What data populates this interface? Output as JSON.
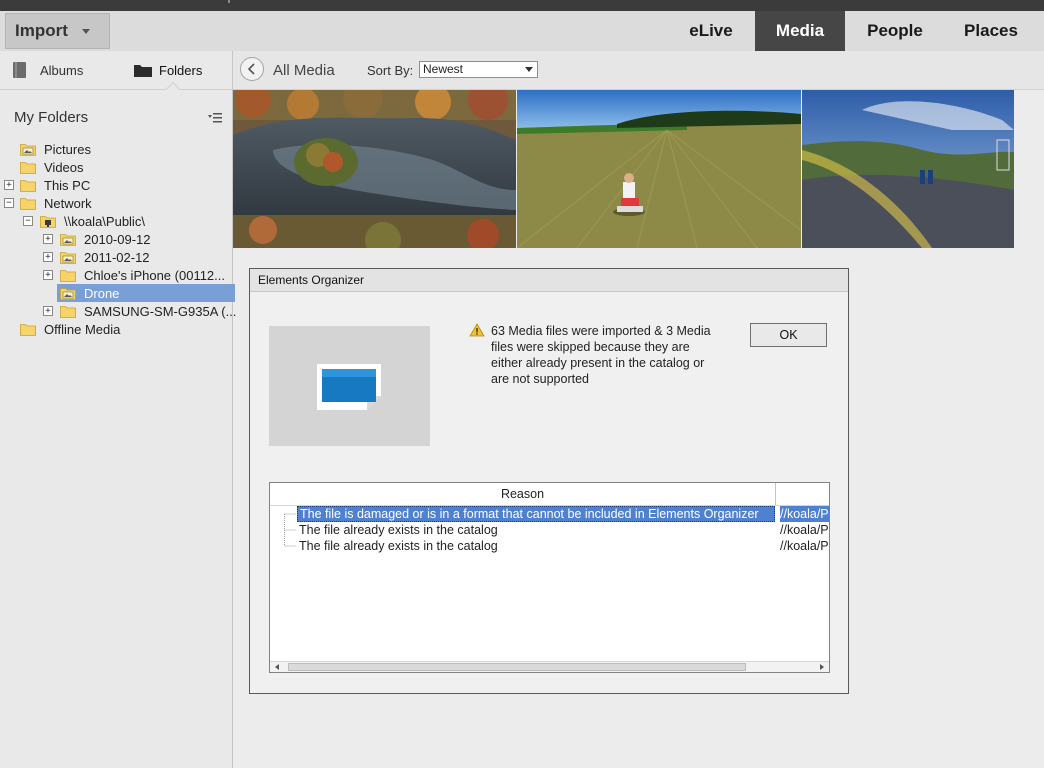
{
  "header": {
    "import_label": "Import",
    "tabs": [
      {
        "label": "eLive",
        "active": false
      },
      {
        "label": "Media",
        "active": true
      },
      {
        "label": "People",
        "active": false
      },
      {
        "label": "Places",
        "active": false
      }
    ]
  },
  "sidebar": {
    "tabs": [
      {
        "label": "Albums",
        "icon": "album-icon",
        "active": false
      },
      {
        "label": "Folders",
        "icon": "folder-icon",
        "active": true
      }
    ],
    "section_title": "My Folders",
    "tree": [
      {
        "label": "Pictures",
        "icon": "image-folder-icon",
        "expander": "",
        "selected": false
      },
      {
        "label": "Videos",
        "icon": "folder-icon",
        "expander": "",
        "selected": false
      },
      {
        "label": "This PC",
        "icon": "folder-icon",
        "expander": "+",
        "selected": false
      },
      {
        "label": "Network",
        "icon": "folder-icon",
        "expander": "−",
        "selected": false
      },
      {
        "label": "\\\\koala\\Public\\",
        "icon": "network-folder-icon",
        "expander": "−",
        "selected": false
      },
      {
        "label": "2010-09-12",
        "icon": "image-folder-icon",
        "expander": "+",
        "selected": false
      },
      {
        "label": "2011-02-12",
        "icon": "image-folder-icon",
        "expander": "+",
        "selected": false
      },
      {
        "label": "Chloe's iPhone (00112...",
        "icon": "folder-icon",
        "expander": "+",
        "selected": false
      },
      {
        "label": "Drone",
        "icon": "image-folder-icon",
        "expander": "",
        "selected": true
      },
      {
        "label": "SAMSUNG-SM-G935A (...",
        "icon": "folder-icon",
        "expander": "+",
        "selected": false
      },
      {
        "label": "Offline Media",
        "icon": "folder-icon",
        "expander": "",
        "selected": false
      }
    ]
  },
  "toolbar": {
    "breadcrumb": "All Media",
    "sort_label": "Sort By:",
    "sort_value": "Newest"
  },
  "dialog": {
    "title": "Elements Organizer",
    "message": "63 Media files were imported & 3 Media files were skipped because they are either already present in the catalog or are not supported",
    "ok_label": "OK",
    "column_reason": "Reason",
    "rows": [
      {
        "reason": "The file is damaged or is in a format that cannot be included in Elements Organizer",
        "path": "//koala/P",
        "selected": true
      },
      {
        "reason": "The file already exists in the catalog",
        "path": "//koala/P",
        "selected": false
      },
      {
        "reason": "The file already exists in the catalog",
        "path": "//koala/P",
        "selected": false
      }
    ]
  },
  "colors": {
    "active_tab": "#464646",
    "selection": "#7a9ed6",
    "list_selection": "#4e81cf"
  }
}
